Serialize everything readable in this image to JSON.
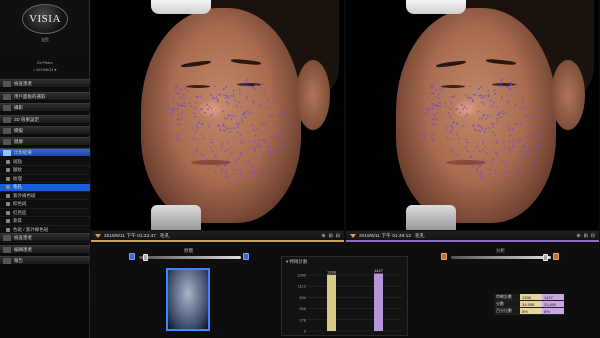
{
  "app": {
    "logo_text": "VISIA",
    "subtitle": "全民",
    "user_line": "ID:Pietro",
    "user_sub": "• 2019/6/11 ▾"
  },
  "sidebar": {
    "menus": [
      {
        "label": "檢查患者",
        "active": false
      },
      {
        "label": "用戶面板的選取",
        "active": false
      },
      {
        "label": "攝影",
        "active": false
      },
      {
        "label": "3D 效果設定",
        "active": false
      },
      {
        "label": "模擬",
        "active": false
      },
      {
        "label": "健康",
        "active": false
      },
      {
        "label": "比對結果",
        "active": true
      }
    ],
    "subs": [
      {
        "label": "斑點",
        "active": false
      },
      {
        "label": "皺紋",
        "active": false
      },
      {
        "label": "紋理",
        "active": false
      },
      {
        "label": "毛孔",
        "active": true
      },
      {
        "label": "紫外線色斑",
        "active": false
      },
      {
        "label": "棕色斑",
        "active": false
      },
      {
        "label": "紅色區",
        "active": false
      },
      {
        "label": "紫質",
        "active": false
      },
      {
        "label": "色斑 / 紫外線色斑",
        "active": false
      },
      {
        "label": "紅 / 棕",
        "active": false
      }
    ],
    "bottom_menus": [
      {
        "label": "檢查患者"
      },
      {
        "label": "編輯患者"
      },
      {
        "label": "報告"
      }
    ]
  },
  "panels": {
    "left": {
      "caption": "2019/6/11 下午 01:22:47",
      "tag": "毛孔",
      "underline_color": "#c9a45a"
    },
    "right": {
      "caption": "2019/6/11 下午 01:49:13",
      "tag": "毛孔",
      "underline_color": "#8f6bbf"
    },
    "tools": [
      "⊕",
      "⊞",
      "⊟"
    ]
  },
  "bottom": {
    "left_slider_label": "原圖",
    "right_slider_label": "分析",
    "chart_title": "▾ 特徵計數"
  },
  "chart_data": {
    "type": "bar",
    "title": "特徵計數",
    "categories": [
      "2019/6/11 下午 01:22:47",
      "2019/6/11 下午 01:49:13"
    ],
    "values": [
      1396,
      1427
    ],
    "colors": [
      "#d8c98a",
      "#b694d6"
    ],
    "yticks": [
      0,
      278,
      556,
      834,
      1112,
      1390
    ],
    "ylim": [
      0,
      1390
    ],
    "xlabel": "",
    "ylabel": ""
  },
  "table": {
    "rows": [
      {
        "h": "特徵計數",
        "a": "1396",
        "b": "1427"
      },
      {
        "h": "分數",
        "a": "34.956",
        "b": "33.890"
      },
      {
        "h": "百分位數",
        "a": "8%",
        "b": "8%"
      }
    ]
  },
  "colors": {
    "accent_blue": "#1560d8",
    "left_accent": "#c9a45a",
    "right_accent": "#8f6bbf"
  }
}
